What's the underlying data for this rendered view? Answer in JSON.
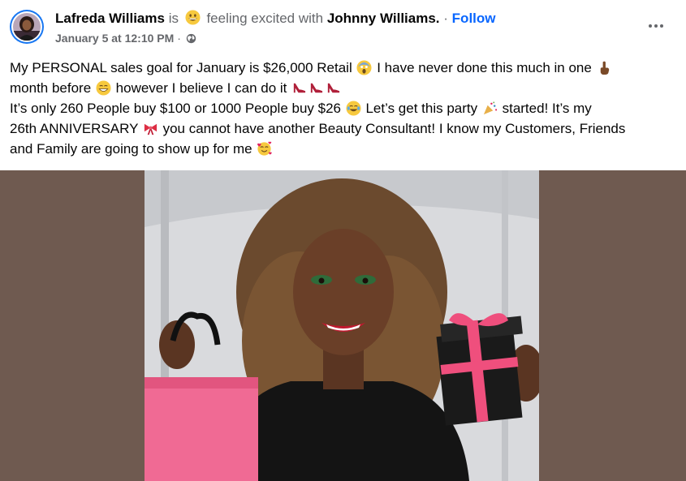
{
  "post": {
    "author": "Lafreda Williams",
    "is_text": "is",
    "feeling_text": "feeling excited with",
    "with_person": "Johnny Williams",
    "period": ".",
    "dot": "·",
    "follow_label": "Follow",
    "timestamp": "January 5 at 12:10 PM",
    "timestamp_dot": "·",
    "audience_icon": "globe-icon",
    "feeling_icon": "grinning-face-icon",
    "more_icon": "more-horizontal-icon"
  },
  "body": {
    "l1a": "My PERSONAL sales goal for January is $26,000 Retail",
    "l1b": "I have never done this much in one",
    "l2a": "month before",
    "l2b": "however I believe I can do it",
    "l3a": "It’s only 260 People buy $100 or 1000 People buy $26",
    "l3b": "Let’s get this party",
    "l3c": "started! It’s my",
    "l4a": "26th ANNIVERSARY",
    "l4b": "you cannot have another Beauty Consultant! I know my Customers, Friends",
    "l5a": "and Family are going to show up for me"
  },
  "colors": {
    "link_blue": "#0866ff",
    "muted_gray": "#65676b",
    "photo_backdrop": "#6f5a50"
  }
}
